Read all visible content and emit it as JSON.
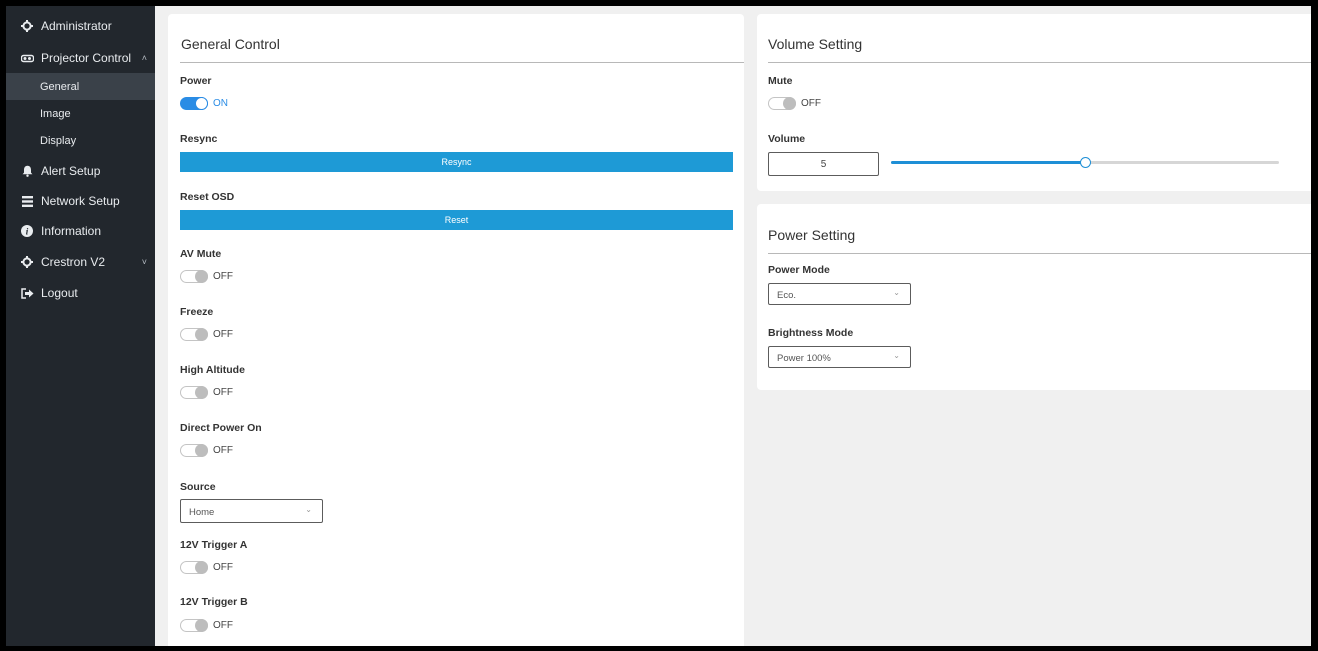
{
  "sidebar": {
    "items": [
      {
        "label": "Administrator",
        "icon": "gear-icon"
      },
      {
        "label": "Projector Control",
        "icon": "projector-icon",
        "chevron": "^"
      },
      {
        "label": "Alert Setup",
        "icon": "bell-icon"
      },
      {
        "label": "Network Setup",
        "icon": "network-icon"
      },
      {
        "label": "Information",
        "icon": "info-icon"
      },
      {
        "label": "Crestron V2",
        "icon": "gear-icon",
        "chevron": "v"
      },
      {
        "label": "Logout",
        "icon": "logout-icon"
      }
    ],
    "subitems": [
      {
        "label": "General",
        "active": true
      },
      {
        "label": "Image"
      },
      {
        "label": "Display"
      }
    ]
  },
  "general": {
    "title": "General Control",
    "power": {
      "label": "Power",
      "state": "ON"
    },
    "resync": {
      "label": "Resync",
      "button": "Resync"
    },
    "reset_osd": {
      "label": "Reset OSD",
      "button": "Reset"
    },
    "av_mute": {
      "label": "AV Mute",
      "state": "OFF"
    },
    "freeze": {
      "label": "Freeze",
      "state": "OFF"
    },
    "high_altitude": {
      "label": "High Altitude",
      "state": "OFF"
    },
    "direct_power_on": {
      "label": "Direct Power On",
      "state": "OFF"
    },
    "source": {
      "label": "Source",
      "value": "Home"
    },
    "trigger_a": {
      "label": "12V Trigger A",
      "state": "OFF"
    },
    "trigger_b": {
      "label": "12V Trigger B",
      "state": "OFF"
    }
  },
  "volume": {
    "title": "Volume Setting",
    "mute": {
      "label": "Mute",
      "state": "OFF"
    },
    "volume": {
      "label": "Volume",
      "value": "5",
      "level_fraction": 0.5
    }
  },
  "power_setting": {
    "title": "Power Setting",
    "power_mode": {
      "label": "Power Mode",
      "value": "Eco."
    },
    "brightness_mode": {
      "label": "Brightness Mode",
      "value": "Power 100%"
    }
  },
  "colors": {
    "accent": "#1e9ad6",
    "toggle_on": "#2a8ce5",
    "sidebar_bg": "#22272d"
  }
}
